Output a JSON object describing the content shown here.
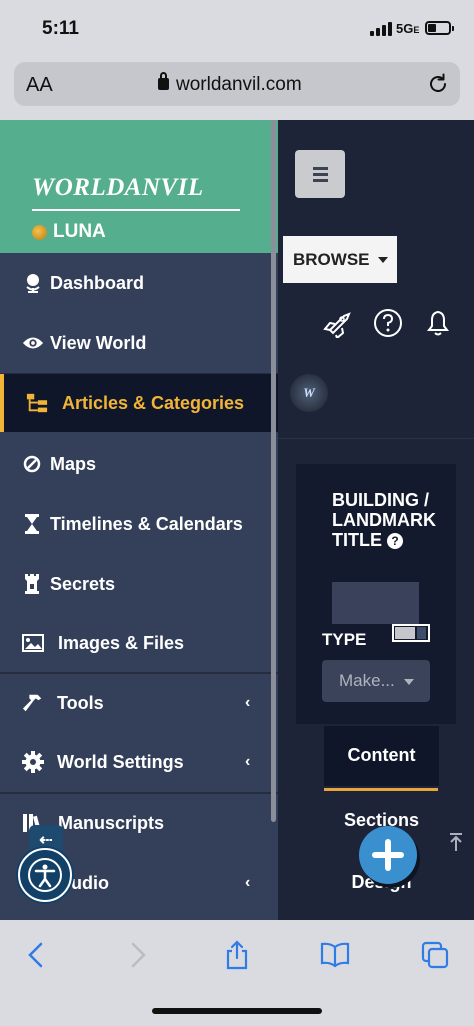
{
  "status_bar": {
    "time": "5:11",
    "network": "5G",
    "network_suffix": "E"
  },
  "url_bar": {
    "text_size_label": "AA",
    "domain": "worldanvil.com"
  },
  "sidebar": {
    "logo_text": "WORLDANVIL",
    "world_name": "LUNA",
    "items": [
      {
        "label": "Dashboard",
        "icon": "globe-icon",
        "active": false,
        "has_submenu": false
      },
      {
        "label": "View World",
        "icon": "eye-icon",
        "active": false,
        "has_submenu": false
      },
      {
        "label": "Articles & Categories",
        "icon": "sitemap-icon",
        "active": true,
        "has_submenu": false
      },
      {
        "label": "Maps",
        "icon": "compass-icon",
        "active": false,
        "has_submenu": false
      },
      {
        "label": "Timelines & Calendars",
        "icon": "hourglass-icon",
        "active": false,
        "has_submenu": false
      },
      {
        "label": "Secrets",
        "icon": "tower-icon",
        "active": false,
        "has_submenu": false
      },
      {
        "label": "Images & Files",
        "icon": "image-icon",
        "active": false,
        "has_submenu": false
      },
      {
        "label": "Tools",
        "icon": "hammer-icon",
        "active": false,
        "has_submenu": true
      },
      {
        "label": "World Settings",
        "icon": "gear-icon",
        "active": false,
        "has_submenu": true
      },
      {
        "label": "Manuscripts",
        "icon": "books-icon",
        "active": false,
        "has_submenu": false
      },
      {
        "label": "Audio",
        "icon": "audio-icon",
        "active": false,
        "has_submenu": true
      }
    ],
    "chevron": "‹"
  },
  "topbar": {
    "browse_label": "BROWSE",
    "icons": [
      "rocket-icon",
      "help-circle-icon",
      "bell-icon"
    ],
    "avatar_text": "W"
  },
  "editor": {
    "field_title": "BUILDING / LANDMARK TITLE",
    "help_icon": "?",
    "type_label": "TYPE",
    "type_select_value": "Make...",
    "tabs": [
      "Content",
      "Sections",
      "Design"
    ],
    "active_tab": "Content"
  },
  "widgets": {
    "back_arrow": "⇠",
    "fab_label": "add"
  },
  "colors": {
    "sidebar_bg": "#34405a",
    "brand_green": "#55ae8e",
    "accent_orange": "#f2b437",
    "content_bg": "#1d2437",
    "fab_blue": "#3a90cf"
  }
}
